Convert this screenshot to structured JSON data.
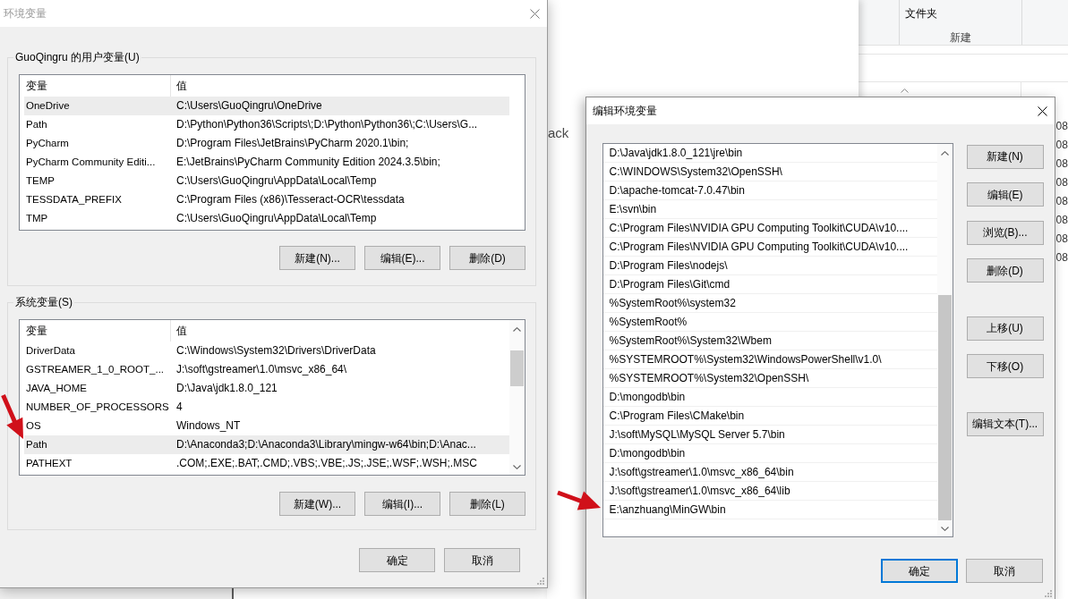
{
  "explorer": {
    "ribbon_button": "文件夹",
    "ribbon_group": "新建",
    "column_cells": [
      "08",
      "08",
      "08",
      "08",
      "08",
      "08",
      "08",
      "08"
    ]
  },
  "background_window": {
    "text": "ack"
  },
  "env_dialog": {
    "title": "环境变量",
    "active": false,
    "user_vars": {
      "label": "GuoQingru 的用户变量(U)",
      "columns": [
        "变量",
        "值"
      ],
      "rows": [
        {
          "name": "OneDrive",
          "value": "C:\\Users\\GuoQingru\\OneDrive",
          "selected": true
        },
        {
          "name": "Path",
          "value": "D:\\Python\\Python36\\Scripts\\;D:\\Python\\Python36\\;C:\\Users\\G...",
          "selected": false
        },
        {
          "name": "PyCharm",
          "value": "D:\\Program Files\\JetBrains\\PyCharm 2020.1\\bin;",
          "selected": false
        },
        {
          "name": "PyCharm Community Editi...",
          "value": "E:\\JetBrains\\PyCharm Community Edition 2024.3.5\\bin;",
          "selected": false
        },
        {
          "name": "TEMP",
          "value": "C:\\Users\\GuoQingru\\AppData\\Local\\Temp",
          "selected": false
        },
        {
          "name": "TESSDATA_PREFIX",
          "value": "C:\\Program Files (x86)\\Tesseract-OCR\\tessdata",
          "selected": false
        },
        {
          "name": "TMP",
          "value": "C:\\Users\\GuoQingru\\AppData\\Local\\Temp",
          "selected": false
        }
      ],
      "buttons": [
        "新建(N)...",
        "编辑(E)...",
        "删除(D)"
      ]
    },
    "system_vars": {
      "label": "系统变量(S)",
      "scrollable": true,
      "columns": [
        "变量",
        "值"
      ],
      "rows": [
        {
          "name": "DriverData",
          "value": "C:\\Windows\\System32\\Drivers\\DriverData",
          "selected": false
        },
        {
          "name": "GSTREAMER_1_0_ROOT_...",
          "value": "J:\\soft\\gstreamer\\1.0\\msvc_x86_64\\",
          "selected": false
        },
        {
          "name": "JAVA_HOME",
          "value": "D:\\Java\\jdk1.8.0_121",
          "selected": false
        },
        {
          "name": "NUMBER_OF_PROCESSORS",
          "value": "4",
          "selected": false
        },
        {
          "name": "OS",
          "value": "Windows_NT",
          "selected": false
        },
        {
          "name": "Path",
          "value": "D:\\Anaconda3;D:\\Anaconda3\\Library\\mingw-w64\\bin;D:\\Anac...",
          "selected": true
        },
        {
          "name": "PATHEXT",
          "value": ".COM;.EXE;.BAT;.CMD;.VBS;.VBE;.JS;.JSE;.WSF;.WSH;.MSC",
          "selected": false
        }
      ],
      "buttons": [
        "新建(W)...",
        "编辑(I)...",
        "删除(L)"
      ]
    },
    "buttons": [
      {
        "label": "确定",
        "default": false
      },
      {
        "label": "取消",
        "default": false
      }
    ]
  },
  "edit_dialog": {
    "title": "编辑环境变量",
    "active": true,
    "scrollable": true,
    "entries": [
      {
        "text": "D:\\Java\\jdk1.8.0_121\\jre\\bin",
        "selected": false
      },
      {
        "text": "C:\\WINDOWS\\System32\\OpenSSH\\",
        "selected": false
      },
      {
        "text": "D:\\apache-tomcat-7.0.47\\bin",
        "selected": false
      },
      {
        "text": "E:\\svn\\bin",
        "selected": false
      },
      {
        "text": "C:\\Program Files\\NVIDIA GPU Computing Toolkit\\CUDA\\v10....",
        "selected": false
      },
      {
        "text": "C:\\Program Files\\NVIDIA GPU Computing Toolkit\\CUDA\\v10....",
        "selected": false
      },
      {
        "text": "D:\\Program Files\\nodejs\\",
        "selected": false
      },
      {
        "text": "D:\\Program Files\\Git\\cmd",
        "selected": false
      },
      {
        "text": "%SystemRoot%\\system32",
        "selected": false
      },
      {
        "text": "%SystemRoot%",
        "selected": false
      },
      {
        "text": "%SystemRoot%\\System32\\Wbem",
        "selected": false
      },
      {
        "text": "%SYSTEMROOT%\\System32\\WindowsPowerShell\\v1.0\\",
        "selected": false
      },
      {
        "text": "%SYSTEMROOT%\\System32\\OpenSSH\\",
        "selected": false
      },
      {
        "text": "D:\\mongodb\\bin",
        "selected": false
      },
      {
        "text": "C:\\Program Files\\CMake\\bin",
        "selected": false
      },
      {
        "text": "J:\\soft\\MySQL\\MySQL Server 5.7\\bin",
        "selected": false
      },
      {
        "text": "D:\\mongodb\\bin",
        "selected": false
      },
      {
        "text": "J:\\soft\\gstreamer\\1.0\\msvc_x86_64\\bin",
        "selected": false
      },
      {
        "text": "J:\\soft\\gstreamer\\1.0\\msvc_x86_64\\lib",
        "selected": false
      },
      {
        "text": "E:\\anzhuang\\MinGW\\bin",
        "selected": false
      }
    ],
    "button_groups": [
      [
        "新建(N)",
        "编辑(E)",
        "浏览(B)...",
        "删除(D)"
      ],
      [
        "上移(U)",
        "下移(O)"
      ],
      [
        "编辑文本(T)..."
      ]
    ],
    "buttons": [
      {
        "label": "确定",
        "default": true
      },
      {
        "label": "取消",
        "default": false
      }
    ]
  }
}
